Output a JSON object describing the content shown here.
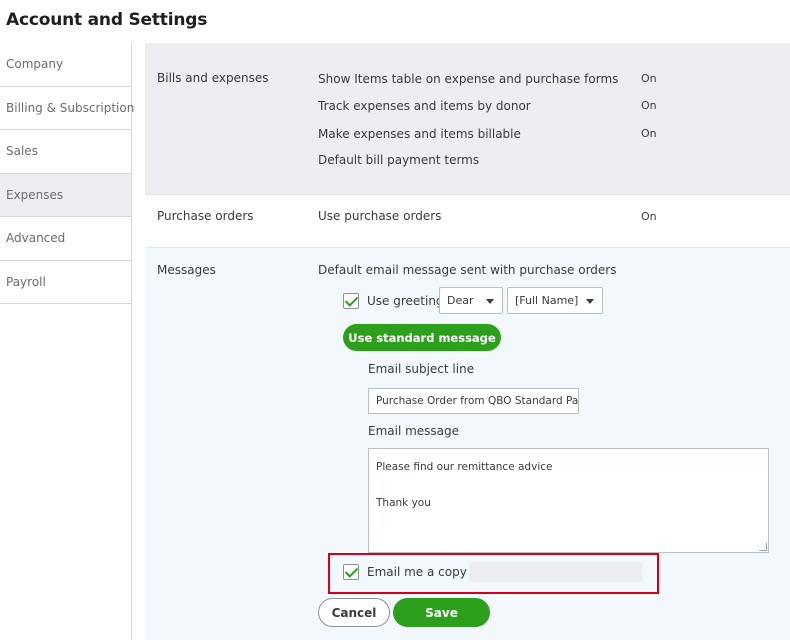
{
  "page": {
    "title": "Account and Settings"
  },
  "sidebar": {
    "items": [
      {
        "label": "Company"
      },
      {
        "label": "Billing & Subscription"
      },
      {
        "label": "Sales"
      },
      {
        "label": "Expenses"
      },
      {
        "label": "Advanced"
      },
      {
        "label": "Payroll"
      }
    ]
  },
  "bills": {
    "title": "Bills and expenses",
    "rows": [
      {
        "label": "Show Items table on expense and purchase forms",
        "value": "On"
      },
      {
        "label": "Track expenses and items by donor",
        "value": "On"
      },
      {
        "label": "Make expenses and items billable",
        "value": "On"
      },
      {
        "label": "Default bill payment terms",
        "value": ""
      }
    ]
  },
  "purchase_orders": {
    "title": "Purchase orders",
    "row_label": "Use purchase orders",
    "row_value": "On"
  },
  "messages": {
    "title": "Messages",
    "description": "Default email message sent with purchase orders",
    "use_greeting_label": "Use greeting",
    "greeting_select": "Dear",
    "name_select": "[Full Name]",
    "standard_message_button": "Use standard message",
    "subject_label": "Email subject line",
    "subject_value": "Purchase Order from QBO Standard Pa",
    "message_label": "Email message",
    "message_lines": [
      "Please find our remittance advice",
      "Thank you"
    ],
    "email_copy_label": "Email me a copy at",
    "cancel_button": "Cancel",
    "save_button": "Save"
  },
  "colors": {
    "accent_green": "#2ca01c",
    "highlight_red": "#d0021b"
  }
}
